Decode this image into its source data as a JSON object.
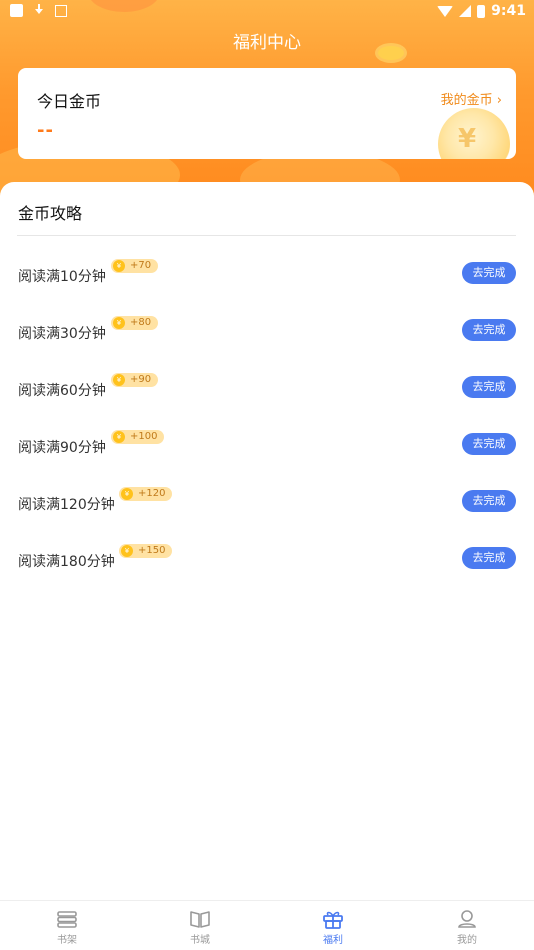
{
  "status_bar": {
    "time": "9:41"
  },
  "header": {
    "title": "福利中心"
  },
  "coin_card": {
    "label": "今日金币",
    "value": "--",
    "my_coins_link": "我的金币 ›"
  },
  "tasks_section": {
    "title": "金币攻略",
    "items": [
      {
        "name": "阅读满10分钟",
        "reward": "+70",
        "button": "去完成"
      },
      {
        "name": "阅读满30分钟",
        "reward": "+80",
        "button": "去完成"
      },
      {
        "name": "阅读满60分钟",
        "reward": "+90",
        "button": "去完成"
      },
      {
        "name": "阅读满90分钟",
        "reward": "+100",
        "button": "去完成"
      },
      {
        "name": "阅读满120分钟",
        "reward": "+120",
        "button": "去完成"
      },
      {
        "name": "阅读满180分钟",
        "reward": "+150",
        "button": "去完成"
      }
    ]
  },
  "tab_bar": {
    "items": [
      {
        "label": "书架",
        "icon": "bookshelf-icon",
        "active": false
      },
      {
        "label": "书城",
        "icon": "book-open-icon",
        "active": false
      },
      {
        "label": "福利",
        "icon": "gift-icon",
        "active": true
      },
      {
        "label": "我的",
        "icon": "profile-icon",
        "active": false
      }
    ]
  },
  "colors": {
    "accent": "#4a7af0",
    "header_orange": "#ff9a2e",
    "coin_value": "#ff7a1a"
  }
}
